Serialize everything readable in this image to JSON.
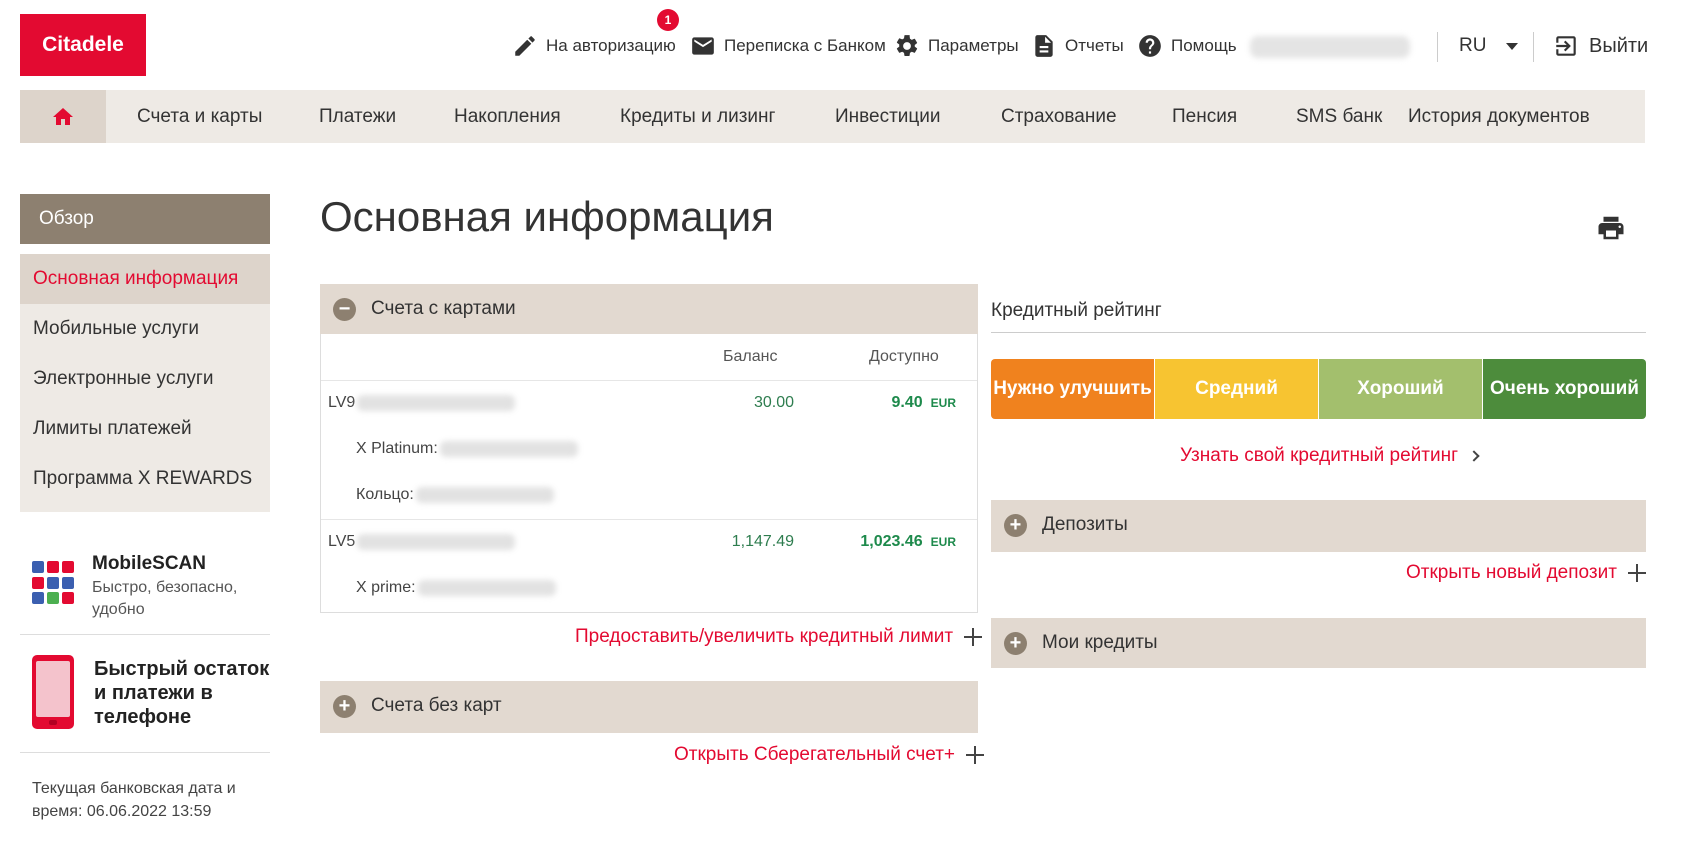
{
  "header": {
    "logo": "Citadele",
    "authorize": "На авторизацию",
    "authorize_badge": "1",
    "messages": "Переписка с Банком",
    "settings": "Параметры",
    "reports": "Отчеты",
    "help": "Помощь",
    "language": "RU",
    "logout": "Выйти"
  },
  "nav": {
    "items": [
      "Счета и карты",
      "Платежи",
      "Накопления",
      "Кредиты и лизинг",
      "Инвестиции",
      "Страхование",
      "Пенсия",
      "SMS банк",
      "История документов"
    ]
  },
  "sidebar": {
    "heading": "Обзор",
    "items": [
      "Основная информация",
      "Мобильные услуги",
      "Электронные услуги",
      "Лимиты платежей",
      "Программа X REWARDS"
    ],
    "mobilescan_title": "MobileSCAN",
    "mobilescan_sub": "Быстро, безопасно, удобно",
    "quick_title": "Быстрый остаток и платежи в телефоне",
    "bank_date": "Текущая банковская дата и время: 06.06.2022 13:59"
  },
  "main": {
    "title": "Основная информация",
    "cards_section": "Счета с картами",
    "col_balance": "Баланс",
    "col_available": "Доступно",
    "accounts": [
      {
        "iban_prefix": "LV9",
        "balance": "30.00",
        "available": "9.40",
        "currency": "EUR",
        "card1_label": "X Platinum:",
        "card2_label": "Кольцо:"
      },
      {
        "iban_prefix": "LV5",
        "balance": "1,147.49",
        "available": "1,023.46",
        "currency": "EUR",
        "card1_label": "X prime:"
      }
    ],
    "credit_limit_link": "Предоставить/увеличить кредитный лимит",
    "no_cards_section": "Счета без карт",
    "open_savings_link": "Открыть Сберегательный счет+",
    "credit_rating_title": "Кредитный рейтинг",
    "rating_levels": [
      "Нужно улучшить",
      "Средний",
      "Хороший",
      "Очень хороший"
    ],
    "rating_colors": [
      "#f0821e",
      "#f7c431",
      "#a3bf6d",
      "#4d8c3c"
    ],
    "credit_rating_link": "Узнать свой кредитный рейтинг",
    "deposits_section": "Депозиты",
    "open_deposit_link": "Открыть новый депозит",
    "loans_section": "Мои кредиты"
  }
}
